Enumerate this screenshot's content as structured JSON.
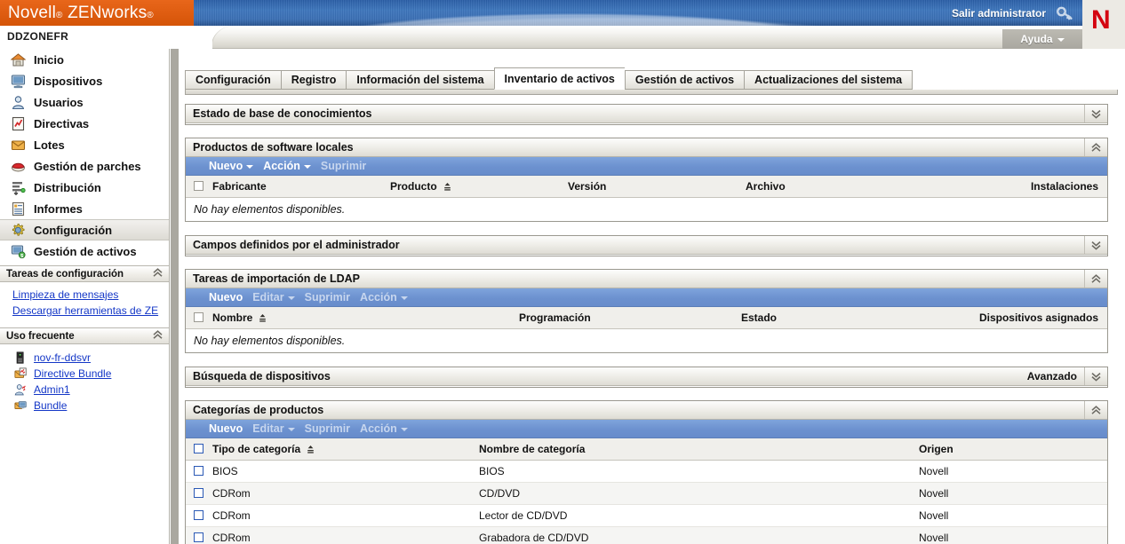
{
  "banner": {
    "brand_novell": "Novell",
    "brand_reg": "®",
    "brand_zenworks": "ZENworks",
    "logout_label": "Salir administrator",
    "key_icon": "key-icon",
    "logo_letter": "N"
  },
  "zonebar": {
    "zone_name": "DDZONEFR",
    "help_label": "Ayuda"
  },
  "sidebar": {
    "nav_items": [
      {
        "label": "Inicio",
        "icon": "home-icon",
        "active": false
      },
      {
        "label": "Dispositivos",
        "icon": "monitor-icon",
        "active": false
      },
      {
        "label": "Usuarios",
        "icon": "user-icon",
        "active": false
      },
      {
        "label": "Directivas",
        "icon": "policy-icon",
        "active": false
      },
      {
        "label": "Lotes",
        "icon": "bundle-icon",
        "active": false
      },
      {
        "label": "Gestión de parches",
        "icon": "patch-icon",
        "active": false
      },
      {
        "label": "Distribución",
        "icon": "deployment-icon",
        "active": false
      },
      {
        "label": "Informes",
        "icon": "report-icon",
        "active": false
      },
      {
        "label": "Configuración",
        "icon": "configuration-icon",
        "active": true
      },
      {
        "label": "Gestión de activos",
        "icon": "asset-management-icon",
        "active": false
      }
    ],
    "config_tasks": {
      "title": "Tareas de configuración",
      "links": [
        "Limpieza de mensajes",
        "Descargar herramientas de ZE"
      ]
    },
    "frequent_use": {
      "title": "Uso frecuente",
      "items": [
        {
          "label": "nov-fr-ddsvr",
          "icon": "server-icon"
        },
        {
          "label": "Directive Bundle",
          "icon": "policy-bundle-icon"
        },
        {
          "label": "Admin1",
          "icon": "admin-user-icon"
        },
        {
          "label": "Bundle",
          "icon": "bundle-device-icon"
        }
      ]
    }
  },
  "tabs": [
    {
      "label": "Configuración",
      "active": false
    },
    {
      "label": "Registro",
      "active": false
    },
    {
      "label": "Información del sistema",
      "active": false
    },
    {
      "label": "Inventario de activos",
      "active": true
    },
    {
      "label": "Gestión de activos",
      "active": false
    },
    {
      "label": "Actualizaciones del sistema",
      "active": false
    }
  ],
  "panels": {
    "knowledge_base": {
      "title": "Estado de base de conocimientos",
      "state": "collapsed"
    },
    "local_software": {
      "title": "Productos de software locales",
      "state": "expanded",
      "toolbar": [
        {
          "label": "Nuevo",
          "caret": true,
          "dim": false
        },
        {
          "label": "Acción",
          "caret": true,
          "dim": false
        },
        {
          "label": "Suprimir",
          "caret": false,
          "dim": true
        }
      ],
      "columns": [
        "Fabricante",
        "Producto",
        "Versión",
        "Archivo",
        "Instalaciones"
      ],
      "sort_column": "Producto",
      "empty_message": "No hay elementos disponibles."
    },
    "admin_fields": {
      "title": "Campos definidos por el administrador",
      "state": "collapsed"
    },
    "ldap_import": {
      "title": "Tareas de importación de LDAP",
      "state": "expanded",
      "toolbar": [
        {
          "label": "Nuevo",
          "caret": false,
          "dim": false
        },
        {
          "label": "Editar",
          "caret": true,
          "dim": true
        },
        {
          "label": "Suprimir",
          "caret": false,
          "dim": true
        },
        {
          "label": "Acción",
          "caret": true,
          "dim": true
        }
      ],
      "columns": [
        "Nombre",
        "Programación",
        "Estado",
        "Dispositivos asignados"
      ],
      "sort_column": "Nombre",
      "empty_message": "No hay elementos disponibles."
    },
    "device_search": {
      "title": "Búsqueda de dispositivos",
      "state": "collapsed",
      "advanced_label": "Avanzado"
    },
    "product_categories": {
      "title": "Categorías de productos",
      "state": "expanded",
      "toolbar": [
        {
          "label": "Nuevo",
          "caret": false,
          "dim": false
        },
        {
          "label": "Editar",
          "caret": true,
          "dim": true
        },
        {
          "label": "Suprimir",
          "caret": false,
          "dim": true
        },
        {
          "label": "Acción",
          "caret": true,
          "dim": true
        }
      ],
      "columns": [
        "Tipo de categoría",
        "Nombre de categoría",
        "Origen"
      ],
      "sort_column": "Tipo de categoría",
      "rows": [
        {
          "tipo": "BIOS",
          "nombre": "BIOS",
          "origen": "Novell"
        },
        {
          "tipo": "CDRom",
          "nombre": "CD/DVD",
          "origen": "Novell"
        },
        {
          "tipo": "CDRom",
          "nombre": "Lector de CD/DVD",
          "origen": "Novell"
        },
        {
          "tipo": "CDRom",
          "nombre": "Grabadora de CD/DVD",
          "origen": "Novell"
        }
      ]
    }
  },
  "colors": {
    "brand_orange": "#de5c10",
    "banner_blue": "#3a6fb5",
    "toolbar_blue": "#6c91cf",
    "link_blue": "#1437c7",
    "logo_red": "#d40511"
  }
}
